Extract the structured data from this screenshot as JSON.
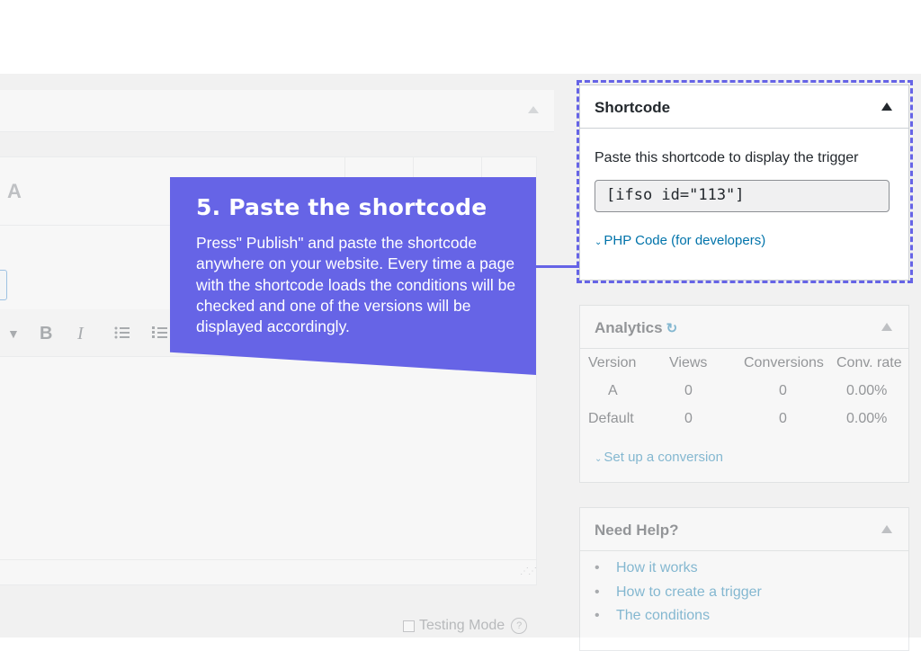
{
  "editor": {
    "version_tab": "A",
    "toolbar": {
      "bold": "B",
      "italic": "I"
    },
    "testing_mode_label": "Testing Mode",
    "help_glyph": "?"
  },
  "callout": {
    "title": "5. Paste the shortcode",
    "text": "Press\" Publish\" and paste the shortcode anywhere on your website. Every time a page with the shortcode loads the conditions will be checked and one of the versions will be displayed accordingly.",
    "color": "#6664e6"
  },
  "shortcode_box": {
    "title": "Shortcode",
    "description": "Paste this shortcode to display the trigger",
    "shortcode_value": "[ifso id=\"113\"]",
    "php_link": "PHP Code (for developers)"
  },
  "analytics_box": {
    "title": "Analytics",
    "columns": [
      "Version",
      "Views",
      "Conversions",
      "Conv. rate"
    ],
    "rows": [
      [
        "A",
        "0",
        "0",
        "0.00%"
      ],
      [
        "Default",
        "0",
        "0",
        "0.00%"
      ]
    ],
    "link": "Set up a conversion"
  },
  "help_box": {
    "title": "Need Help?",
    "links": [
      "How it works",
      "How to create a trigger",
      "The conditions"
    ]
  },
  "colors": {
    "accent": "#6664e6",
    "link": "#0073aa"
  }
}
